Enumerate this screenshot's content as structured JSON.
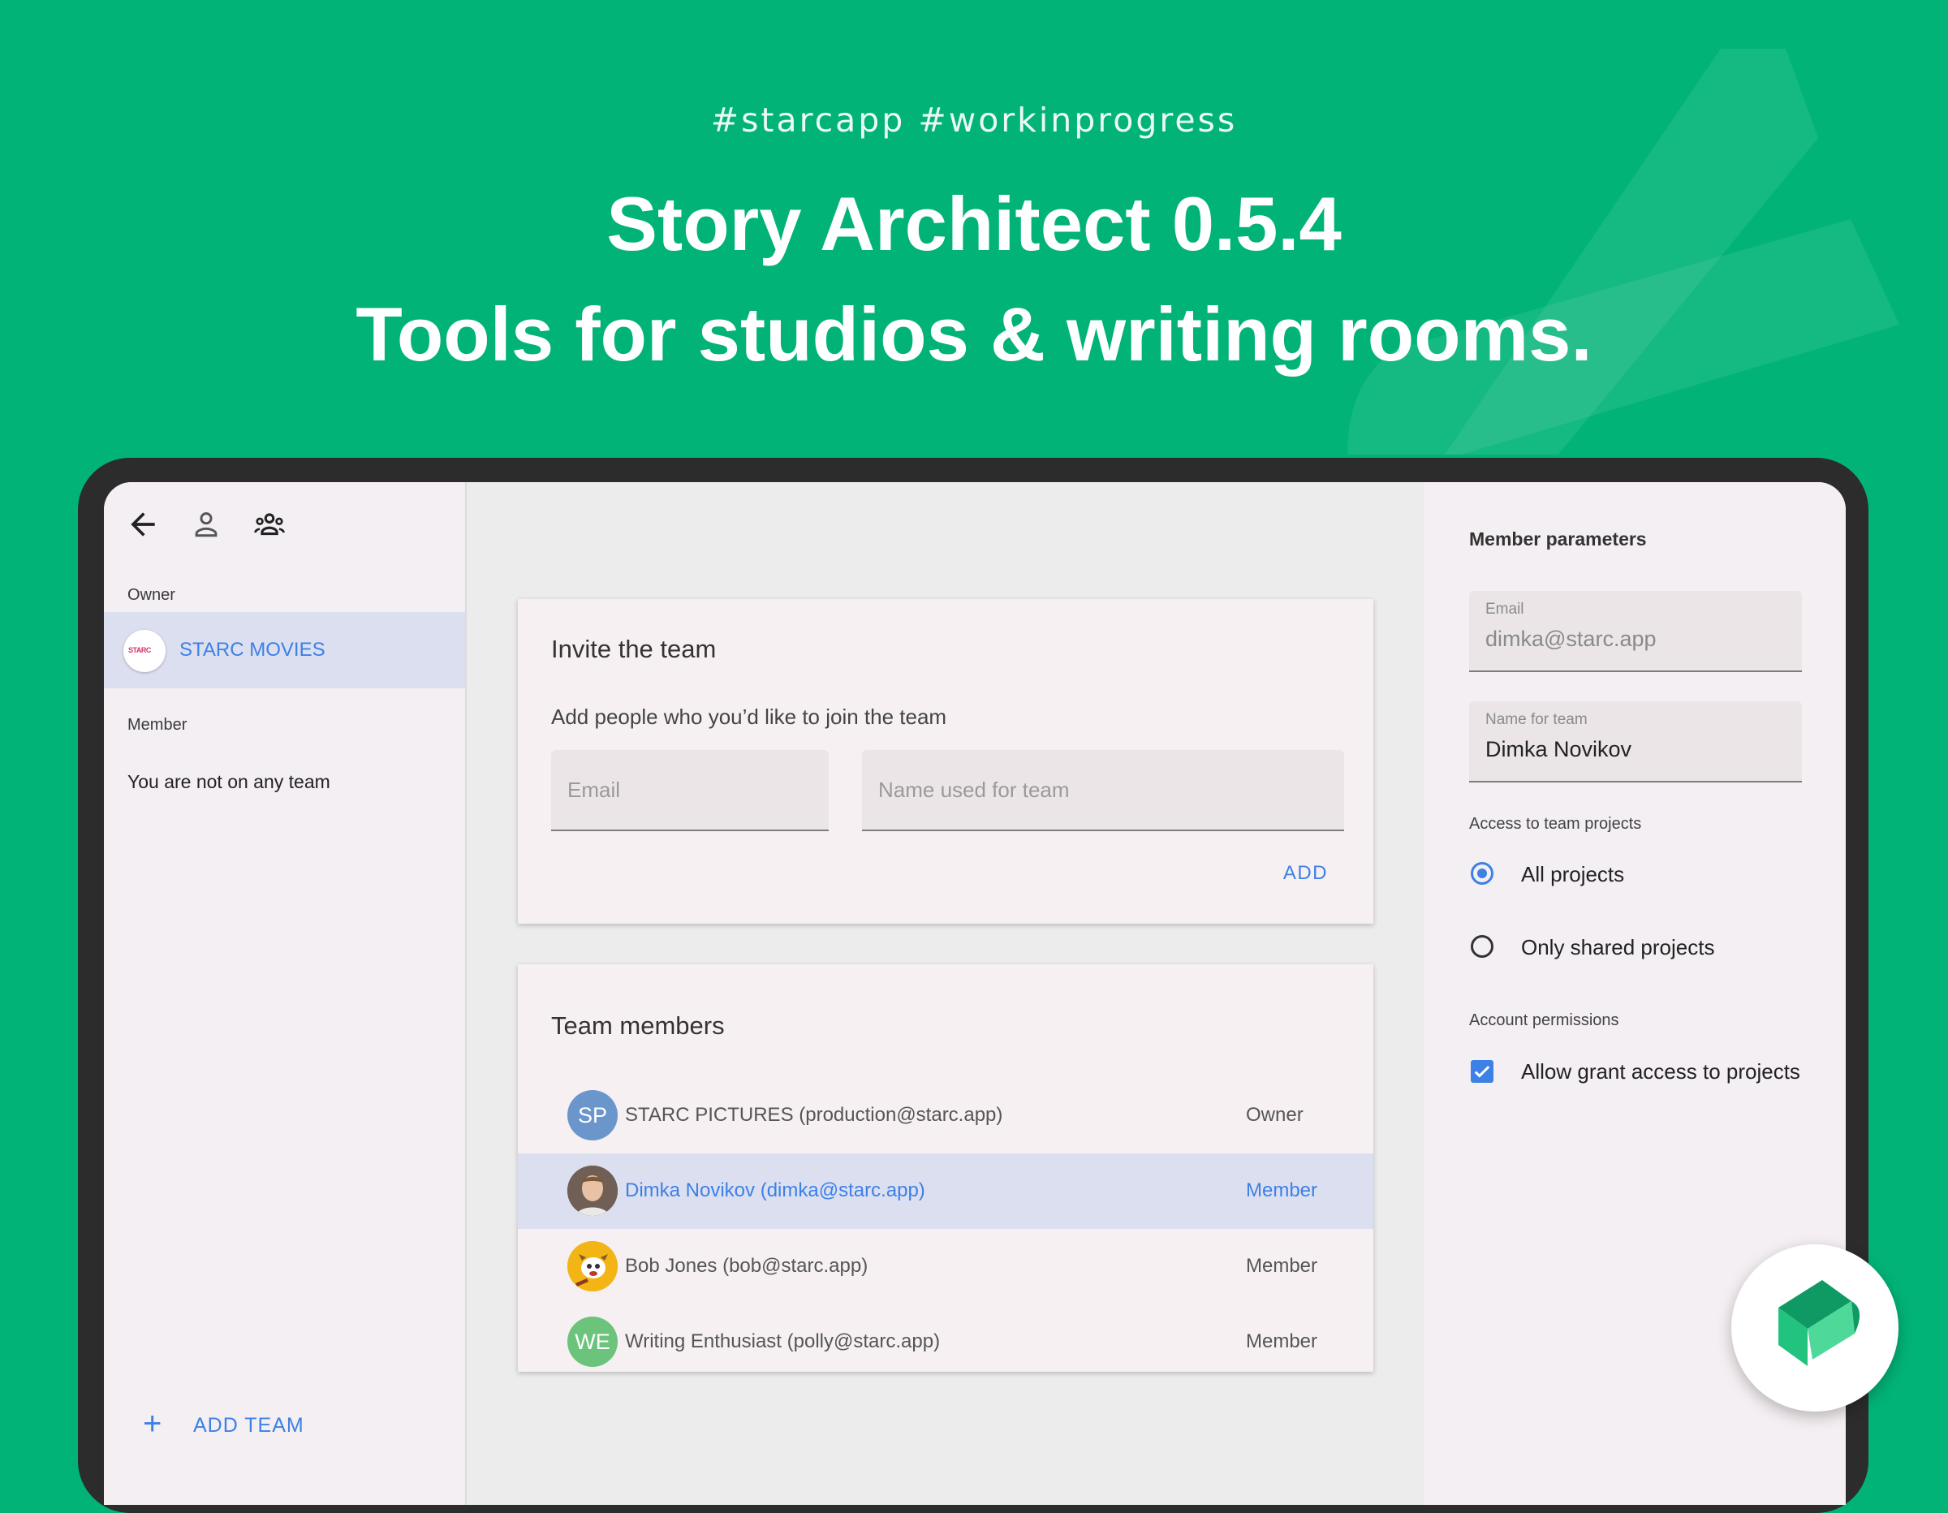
{
  "promo": {
    "hashtags": "#starcapp  #workinprogress",
    "headline_line1": "Story Architect 0.5.4",
    "headline_line2": "Tools for studios & writing rooms."
  },
  "colors": {
    "background": "#02b378",
    "accent": "#3d80e6",
    "selected_row": "#dcdff0"
  },
  "sidebar": {
    "owner_label": "Owner",
    "owner_team": "STARC MOVIES",
    "member_label": "Member",
    "no_team_text": "You are not on any team",
    "add_team_label": "ADD TEAM"
  },
  "invite": {
    "title": "Invite the team",
    "subtitle": "Add people who you’d like to join the team",
    "email_placeholder": "Email",
    "name_placeholder": "Name used for team",
    "add_label": "ADD"
  },
  "team": {
    "title": "Team members",
    "members": [
      {
        "initials": "SP",
        "name": "STARC PICTURES (production@starc.app)",
        "role": "Owner",
        "avatar_color": "#6a96cc"
      },
      {
        "initials": "",
        "name": "Dimka Novikov (dimka@starc.app)",
        "role": "Member",
        "avatar_color": "#8a6e5a"
      },
      {
        "initials": "",
        "name": "Bob Jones (bob@starc.app)",
        "role": "Member",
        "avatar_color": "#f2b515"
      },
      {
        "initials": "WE",
        "name": "Writing Enthusiast (polly@starc.app)",
        "role": "Member",
        "avatar_color": "#6cc47c"
      }
    ]
  },
  "params": {
    "title": "Member parameters",
    "email_label": "Email",
    "email_value": "dimka@starc.app",
    "name_label": "Name for team",
    "name_value": "Dimka Novikov",
    "access_label": "Access to team projects",
    "option_all": "All projects",
    "option_shared": "Only shared projects",
    "selected_access": "All projects",
    "permissions_label": "Account permissions",
    "permission_grant": "Allow grant access to projects",
    "permission_grant_checked": true
  },
  "icons": [
    "arrow-back-icon",
    "person-icon",
    "group-icon",
    "plus-icon",
    "checkmark-icon",
    "app-logo-icon"
  ]
}
